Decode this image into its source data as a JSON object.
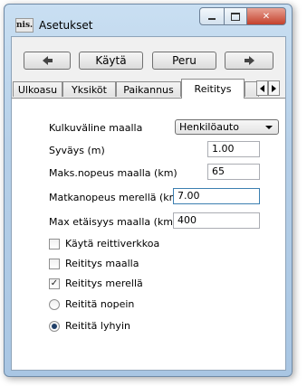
{
  "window": {
    "title": "Asetukset",
    "icon": "app-logo-icon",
    "logo_text": "nis."
  },
  "toolbar": {
    "back_icon": "arrow-left-icon",
    "apply_label": "Käytä",
    "cancel_label": "Peru",
    "forward_icon": "arrow-right-icon"
  },
  "tabs": [
    {
      "label": "Ulkoasu",
      "active": false
    },
    {
      "label": "Yksiköt",
      "active": false
    },
    {
      "label": "Paikannus",
      "active": false
    },
    {
      "label": "Reititys",
      "active": true
    }
  ],
  "routing": {
    "vehicle_label": "Kulkuväline maalla",
    "vehicle_value": "Henkilöauto",
    "depth_label": "Syväys (m)",
    "depth_value": "1.00",
    "max_speed_land_label": "Maks.nopeus maalla (km)",
    "max_speed_land_value": "65",
    "cruise_speed_sea_label": "Matkanopeus merellä (kn)",
    "cruise_speed_sea_value": "7.00",
    "max_distance_land_label": "Max etäisyys maalla (km)",
    "max_distance_land_value": "400",
    "checkboxes": [
      {
        "label": "Käytä reittiverkkoa",
        "checked": false
      },
      {
        "label": "Reititys maalla",
        "checked": false
      },
      {
        "label": "Reititys merellä",
        "checked": true
      }
    ],
    "radios": [
      {
        "label": "Reititä nopein",
        "selected": false
      },
      {
        "label": "Reititä lyhyin",
        "selected": true
      }
    ]
  }
}
